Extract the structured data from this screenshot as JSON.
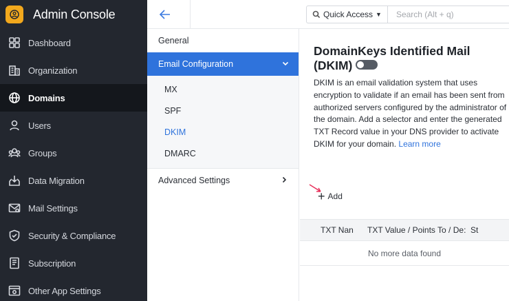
{
  "app": {
    "title": "Admin Console"
  },
  "sidebar": {
    "items": [
      {
        "label": "Dashboard",
        "icon": "dashboard-icon"
      },
      {
        "label": "Organization",
        "icon": "organization-icon"
      },
      {
        "label": "Domains",
        "icon": "globe-icon",
        "active": true
      },
      {
        "label": "Users",
        "icon": "user-icon"
      },
      {
        "label": "Groups",
        "icon": "groups-icon"
      },
      {
        "label": "Data Migration",
        "icon": "migration-icon"
      },
      {
        "label": "Mail Settings",
        "icon": "mail-settings-icon"
      },
      {
        "label": "Security & Compliance",
        "icon": "shield-check-icon"
      },
      {
        "label": "Subscription",
        "icon": "subscription-icon"
      },
      {
        "label": "Other App Settings",
        "icon": "app-settings-icon"
      }
    ]
  },
  "topbar": {
    "quick_access": "Quick Access",
    "search_placeholder": "Search (Alt + q)"
  },
  "subnav": {
    "general": "General",
    "email_config": "Email Configuration",
    "sub_items": [
      "MX",
      "SPF",
      "DKIM",
      "DMARC"
    ],
    "selected_sub": "DKIM",
    "advanced": "Advanced Settings"
  },
  "main": {
    "title": "DomainKeys Identified Mail (DKIM)",
    "toggle_state": "off",
    "description": "DKIM is an email validation system that uses encryption to validate if an email has been sent from authorized servers configured by the administrator of the domain. Add a selector and enter the generated TXT Record value in your DNS provider to activate DKIM for your domain.",
    "learn_more": "Learn more",
    "add_label": "Add",
    "table": {
      "headers": [
        "TXT Nan",
        "TXT Value / Points To / De:",
        "St"
      ],
      "empty_text": "No more data found"
    }
  },
  "colors": {
    "sidebar_bg": "#23272f",
    "accent": "#2f73dc",
    "logo": "#f2a81d",
    "annotation_arrow": "#e8305a"
  }
}
